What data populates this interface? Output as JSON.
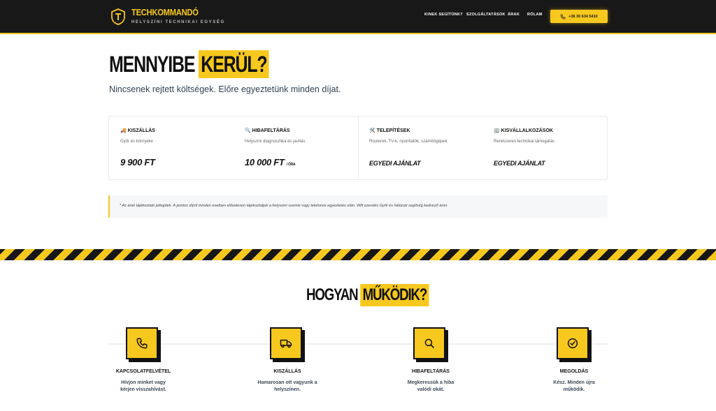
{
  "header": {
    "brand": "TECHKOMMANDÓ",
    "tagline": "HELYSZÍNI TECHNIKAI EGYSÉG",
    "nav": [
      "KINEK SEGÍTÜNK?",
      "SZOLGÁLTATÁSOK",
      "ÁRAK",
      "RÓLAM"
    ],
    "phone": "+36 30 634 5410"
  },
  "pricing": {
    "title_plain": "MENNYIBE",
    "title_highlight": "KERÜL?",
    "subtitle": "Nincsenek rejtett költségek. Előre egyeztetünk minden díjat.",
    "cards": [
      {
        "emoji": "🚚",
        "title": "KISZÁLLÁS",
        "sub": "Győr és környéke",
        "price": "9 900 FT",
        "unit": ""
      },
      {
        "emoji": "🔍",
        "title": "HIBAFELTÁRÁS",
        "sub": "Helyszíni diagnosztika és javítás",
        "price": "10 000 FT",
        "unit": "/ ÓRA"
      },
      {
        "emoji": "🛠️",
        "title": "TELEPÍTÉSEK",
        "sub": "Routerek, TV-k, nyomtatók, számítógépek",
        "price": "EGYEDI AJÁNLAT",
        "unit": ""
      },
      {
        "emoji": "🏢",
        "title": "KISVÁLLALKOZÁSOK",
        "sub": "Rendszeres technikai támogatás",
        "price": "EGYEDI AJÁNLAT",
        "unit": ""
      }
    ],
    "note": "* Az árak tájékoztató jellegűek. A pontos díjról minden esetben előzetesen tájékoztatjuk a helyszíni szemle vagy telefonos egyeztetés után. Wifi szerelés Győr és hálózati segítség kedvező áron."
  },
  "how": {
    "title_plain": "HOGYAN",
    "title_highlight": "MŰKÖDIK?",
    "steps": [
      {
        "icon": "phone-icon",
        "title": "KAPCSOLATFELVÉTEL",
        "desc1": "Hívjon minket vagy",
        "desc2": "kérjen visszahívást."
      },
      {
        "icon": "truck-icon",
        "title": "KISZÁLLÁS",
        "desc1": "Hamarosan ott vagyunk a",
        "desc2": "helyszínen."
      },
      {
        "icon": "search-icon",
        "title": "HIBAFELTÁRÁS",
        "desc1": "Megkeressük a hiba",
        "desc2": "valódi okát."
      },
      {
        "icon": "check-circle-icon",
        "title": "MEGOLDÁS",
        "desc1": "Kész. Minden újra",
        "desc2": "működik."
      }
    ]
  },
  "colors": {
    "accent": "#f7c81e",
    "dark": "#181818"
  }
}
